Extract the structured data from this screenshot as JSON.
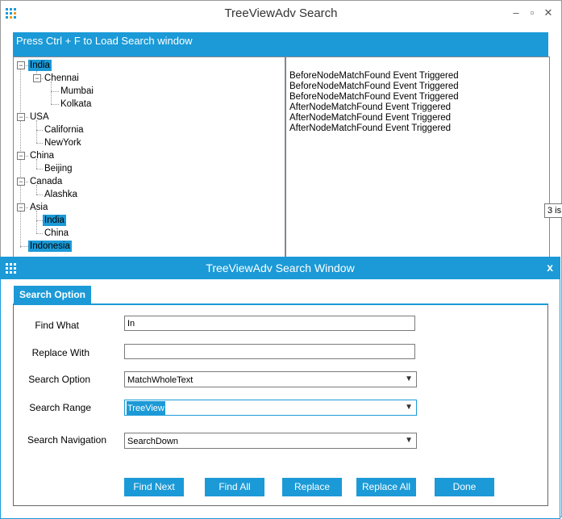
{
  "main_window": {
    "title": "TreeViewAdv Search",
    "minimize": "–",
    "maximize": "▫",
    "close": "✕"
  },
  "banner": {
    "text": "Press Ctrl + F to Load Search window"
  },
  "tree": {
    "india": "India",
    "chennai": "Chennai",
    "mumbai": "Mumbai",
    "kolkata": "Kolkata",
    "usa": "USA",
    "california": "California",
    "newyork": "NewYork",
    "china": "China",
    "beijing": "Beijing",
    "canada": "Canada",
    "alashka": "Alashka",
    "asia": "Asia",
    "asia_india": "India",
    "asia_china": "China",
    "indonesia": "Indonesia"
  },
  "log_lines": [
    "BeforeNodeMatchFound Event Triggered",
    "BeforeNodeMatchFound Event Triggered",
    "BeforeNodeMatchFound Event Triggered",
    "AfterNodeMatchFound Event Triggered",
    "AfterNodeMatchFound Event Triggered",
    "AfterNodeMatchFound Event Triggered"
  ],
  "tooltip": "3 is",
  "dialog": {
    "title": "TreeViewAdv Search Window",
    "close": "x",
    "group_label": "Search Option",
    "find_what_label": "Find What",
    "find_what_value": "In",
    "replace_with_label": "Replace With",
    "replace_with_value": "",
    "search_option_label": "Search Option",
    "search_option_value": "MatchWholeText",
    "search_range_label": "Search Range",
    "search_range_value": "TreeView",
    "search_navigation_label": "Search Navigation",
    "search_navigation_value": "SearchDown",
    "buttons": {
      "find_next": "Find Next",
      "find_all": "Find All",
      "replace": "Replace",
      "replace_all": "Replace All",
      "done": "Done"
    }
  },
  "colors": {
    "accent": "#1b9ad7"
  }
}
